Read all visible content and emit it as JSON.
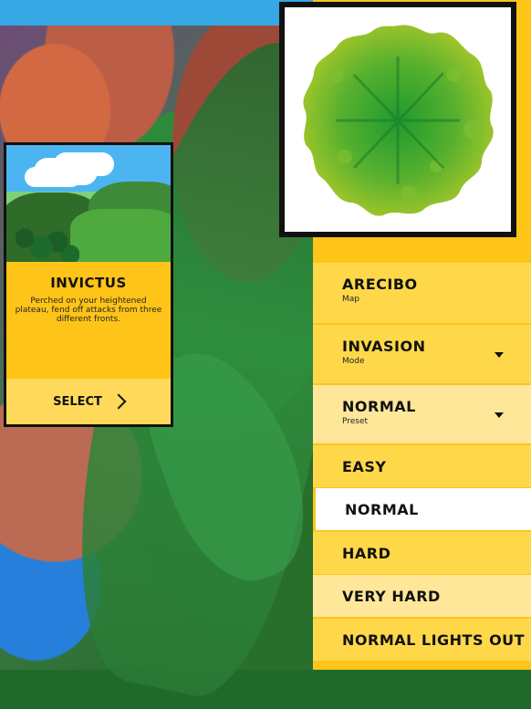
{
  "map_card": {
    "title": "INVICTUS",
    "description": "Perched on your heightened plateau, fend off attacks from three different fronts.",
    "select_label": "SELECT"
  },
  "fields": {
    "map": {
      "value": "ARECIBO",
      "label": "Map"
    },
    "mode": {
      "value": "INVASION",
      "label": "Mode"
    },
    "preset": {
      "value": "NORMAL",
      "label": "Preset"
    }
  },
  "preset_options": [
    "EASY",
    "NORMAL",
    "HARD",
    "VERY HARD",
    "NORMAL LIGHTS OUT"
  ],
  "selected_preset_option": "NORMAL",
  "icons": {
    "select_arrow": "chevron-right-icon",
    "dropdown": "caret-down-icon"
  },
  "colors": {
    "accent_yellow": "#ffc418",
    "light_yellow": "#ffe79a",
    "selected": "#ffffff",
    "border": "#111111"
  }
}
